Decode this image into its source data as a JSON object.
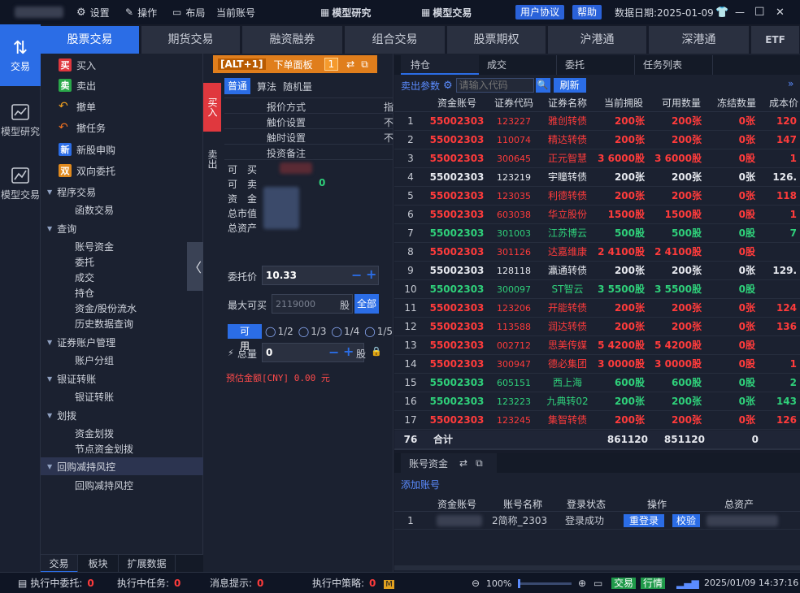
{
  "topbar": {
    "settings": "设置",
    "operate": "操作",
    "layout": "布局",
    "current_account": "当前账号",
    "model_research": "模型研究",
    "model_trade": "模型交易",
    "user_agreement": "用户协议",
    "help": "帮助",
    "data_date": "数据日期:2025-01-09"
  },
  "rail": {
    "items": [
      {
        "label": "交易"
      },
      {
        "label": "模型研究"
      },
      {
        "label": "模型交易"
      }
    ]
  },
  "main_tabs": [
    "股票交易",
    "期货交易",
    "融资融券",
    "组合交易",
    "股票期权",
    "沪港通",
    "深港通",
    "ETF"
  ],
  "sidebar": {
    "items": [
      {
        "label": "买入",
        "badge": "买",
        "badge_color": "#e0383e"
      },
      {
        "label": "卖出",
        "badge": "卖",
        "badge_color": "#2aa84a"
      },
      {
        "label": "撤单"
      },
      {
        "label": "撤任务"
      },
      {
        "label": "新股申购",
        "badge": "新",
        "badge_color": "#2b6de6"
      },
      {
        "label": "双向委托",
        "badge": "双",
        "badge_color": "#e08a1e"
      }
    ],
    "groups": [
      {
        "label": "程序交易",
        "children": [
          "函数交易"
        ]
      },
      {
        "label": "查询",
        "children": [
          "账号资金",
          "委托",
          "成交",
          "持仓",
          "资金/股份流水",
          "历史数据查询"
        ]
      },
      {
        "label": "证券账户管理",
        "children": [
          "账户分组"
        ]
      },
      {
        "label": "银证转账",
        "children": [
          "银证转账"
        ]
      },
      {
        "label": "划拨",
        "children": [
          "资金划拨",
          "节点资金划拨"
        ]
      },
      {
        "label": "回购减持风控",
        "children": [
          "回购减持风控"
        ]
      }
    ],
    "bottom_tabs": [
      "交易",
      "板块",
      "扩展数据"
    ]
  },
  "order": {
    "header_key": "[ALT+1]",
    "header_title": "下单面板",
    "header_num": "1",
    "side_buy": "买入",
    "side_sell": "卖出",
    "mode_tabs": [
      "普通",
      "算法",
      "随机量"
    ],
    "settings": [
      {
        "k": "报价方式",
        "v": "指"
      },
      {
        "k": "触价设置",
        "v": "不"
      },
      {
        "k": "触时设置",
        "v": "不"
      },
      {
        "k": "投资备注",
        "v": ""
      }
    ],
    "info": [
      {
        "k": "可　买",
        "v": ""
      },
      {
        "k": "可　卖",
        "v": "0"
      },
      {
        "k": "资　金",
        "v": ""
      },
      {
        "k": "总市值",
        "v": ""
      },
      {
        "k": "总资产",
        "v": ""
      }
    ],
    "price_label": "委托价",
    "price_value": "10.33",
    "max_label": "最大可买",
    "max_value": "2119000",
    "max_unit": "股",
    "all_btn": "全部",
    "avail_btn": "可　用",
    "fractions": [
      "1/2",
      "1/3",
      "1/4",
      "1/5"
    ],
    "qty_label": "总量",
    "qty_value": "0",
    "qty_unit": "股",
    "estimate": "预估金额[CNY] 0.00 元"
  },
  "positions": {
    "tabs": [
      "持仓",
      "成交",
      "委托",
      "任务列表"
    ],
    "sell_params": "卖出参数",
    "search_placeholder": "请输入代码",
    "refresh": "刷新",
    "columns": [
      "",
      "资金账号",
      "证券代码",
      "证券名称",
      "当前拥股",
      "可用数量",
      "冻结数量",
      "成本价"
    ],
    "rows": [
      {
        "n": "1",
        "acct": "55002303",
        "code": "123227",
        "name": "雅创转债",
        "hold": "200张",
        "avail": "200张",
        "frozen": "0张",
        "cost": "120",
        "c": "red"
      },
      {
        "n": "2",
        "acct": "55002303",
        "code": "110074",
        "name": "精达转债",
        "hold": "200张",
        "avail": "200张",
        "frozen": "0张",
        "cost": "147",
        "c": "red"
      },
      {
        "n": "3",
        "acct": "55002303",
        "code": "300645",
        "name": "正元智慧",
        "hold": "3 6000股",
        "avail": "3 6000股",
        "frozen": "0股",
        "cost": "1",
        "c": "red"
      },
      {
        "n": "4",
        "acct": "55002303",
        "code": "123219",
        "name": "宇瞳转债",
        "hold": "200张",
        "avail": "200张",
        "frozen": "0张",
        "cost": "126.",
        "c": "white"
      },
      {
        "n": "5",
        "acct": "55002303",
        "code": "123035",
        "name": "利德转债",
        "hold": "200张",
        "avail": "200张",
        "frozen": "0张",
        "cost": "118",
        "c": "red"
      },
      {
        "n": "6",
        "acct": "55002303",
        "code": "603038",
        "name": "华立股份",
        "hold": "1500股",
        "avail": "1500股",
        "frozen": "0股",
        "cost": "1",
        "c": "red"
      },
      {
        "n": "7",
        "acct": "55002303",
        "code": "301003",
        "name": "江苏博云",
        "hold": "500股",
        "avail": "500股",
        "frozen": "0股",
        "cost": "7",
        "c": "green"
      },
      {
        "n": "8",
        "acct": "55002303",
        "code": "301126",
        "name": "达嘉维康",
        "hold": "2 4100股",
        "avail": "2 4100股",
        "frozen": "0股",
        "cost": "",
        "c": "red"
      },
      {
        "n": "9",
        "acct": "55002303",
        "code": "128118",
        "name": "瀛通转债",
        "hold": "200张",
        "avail": "200张",
        "frozen": "0张",
        "cost": "129.",
        "c": "white"
      },
      {
        "n": "10",
        "acct": "55002303",
        "code": "300097",
        "name": "ST智云",
        "hold": "3 5500股",
        "avail": "3 5500股",
        "frozen": "0股",
        "cost": "",
        "c": "green"
      },
      {
        "n": "11",
        "acct": "55002303",
        "code": "123206",
        "name": "开能转债",
        "hold": "200张",
        "avail": "200张",
        "frozen": "0张",
        "cost": "124",
        "c": "red"
      },
      {
        "n": "12",
        "acct": "55002303",
        "code": "113588",
        "name": "润达转债",
        "hold": "200张",
        "avail": "200张",
        "frozen": "0张",
        "cost": "136",
        "c": "red"
      },
      {
        "n": "13",
        "acct": "55002303",
        "code": "002712",
        "name": "思美传媒",
        "hold": "5 4200股",
        "avail": "5 4200股",
        "frozen": "0股",
        "cost": "",
        "c": "red"
      },
      {
        "n": "14",
        "acct": "55002303",
        "code": "300947",
        "name": "德必集团",
        "hold": "3 0000股",
        "avail": "3 0000股",
        "frozen": "0股",
        "cost": "1",
        "c": "red"
      },
      {
        "n": "15",
        "acct": "55002303",
        "code": "605151",
        "name": "西上海",
        "hold": "600股",
        "avail": "600股",
        "frozen": "0股",
        "cost": "2",
        "c": "green"
      },
      {
        "n": "16",
        "acct": "55002303",
        "code": "123223",
        "name": "九典转02",
        "hold": "200张",
        "avail": "200张",
        "frozen": "0张",
        "cost": "143",
        "c": "green"
      },
      {
        "n": "17",
        "acct": "55002303",
        "code": "123245",
        "name": "集智转债",
        "hold": "200张",
        "avail": "200张",
        "frozen": "0张",
        "cost": "126",
        "c": "red"
      }
    ],
    "total": {
      "n": "76",
      "label": "合计",
      "hold": "861120",
      "avail": "851120",
      "frozen": "0"
    }
  },
  "account": {
    "tab": "账号资金",
    "add": "添加账号",
    "columns": [
      "",
      "资金账号",
      "账号名称",
      "登录状态",
      "操作",
      "总资产"
    ],
    "row": {
      "n": "1",
      "name": "2简称_2303",
      "status": "登录成功",
      "relogin": "重登录",
      "verify": "校验"
    }
  },
  "status": {
    "exec_orders": "执行中委托:",
    "exec_orders_n": "0",
    "exec_tasks": "执行中任务:",
    "exec_tasks_n": "0",
    "msg": "消息提示:",
    "msg_n": "0",
    "exec_strategy": "执行中策略:",
    "exec_strategy_n": "0",
    "zoom": "100%",
    "trade": "交易",
    "quote": "行情",
    "datetime": "2025/01/09 14:37:16"
  }
}
